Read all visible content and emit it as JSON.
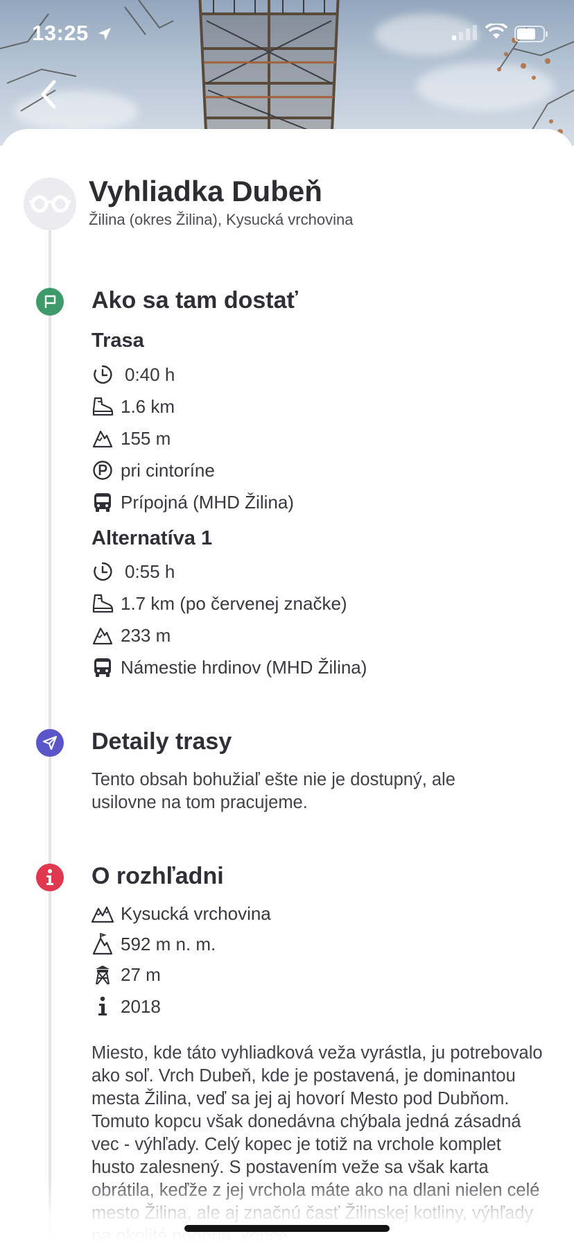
{
  "status_bar": {
    "time": "13:25"
  },
  "header": {
    "title": "Vyhliadka Dubeň",
    "subtitle": "Žilina (okres Žilina), Kysucká vrchovina"
  },
  "how_to_get": {
    "heading": "Ako sa tam dostať",
    "route": {
      "label": "Trasa",
      "duration": "0:40 h",
      "distance": "1.6 km",
      "elevation": "155 m",
      "parking": "pri cintoríne",
      "bus": "Prípojná (MHD Žilina)"
    },
    "alternative": {
      "label": "Alternatíva 1",
      "duration": "0:55 h",
      "distance": "1.7 km (po červenej značke)",
      "elevation": "233 m",
      "bus": "Námestie hrdinov (MHD Žilina)"
    }
  },
  "route_details": {
    "heading": "Detaily trasy",
    "text": "Tento obsah bohužiaľ ešte nie je dostupný, ale usilovne na tom pracujeme."
  },
  "about": {
    "heading": "O rozhľadni",
    "region": "Kysucká vrchovina",
    "altitude": "592 m n. m.",
    "height": "27 m",
    "year": "2018",
    "description": "Miesto, kde táto vyhliadková veža vyrástla, ju potrebovalo ako soľ. Vrch Dubeň, kde je postavená, je dominantou mesta Žilina, veď sa jej aj hovorí Mesto pod Dubňom. Tomuto kopcu však donedávna chýbala jedná zásadná vec - výhľady. Celý kopec je totiž na vrchole komplet husto zalesnený. S postavením veže sa však karta obrátila, keďže z jej vrchola máte ako na dlani nielen celé mesto Žilina, ale aj značnú časť Žilinskej kotliny, výhľady na okolité pohoria, kopce"
  },
  "colors": {
    "section_green": "#3f9a6b",
    "section_purple": "#5a55c9",
    "section_red": "#e0384e",
    "timeline": "#e4e4e9"
  },
  "icons": {
    "back": "chevron-left-icon",
    "avatar": "glasses-icon",
    "how_to_get": "flag-icon",
    "route_details": "navigation-arrow-icon",
    "about": "info-icon",
    "duration": "clock-icon",
    "distance": "hiking-boot-icon",
    "elevation": "mountain-icon",
    "parking": "parking-icon",
    "bus": "bus-icon",
    "region": "mountains-icon",
    "altitude": "mountain-peak-icon",
    "height": "tower-icon",
    "year": "info-i-icon"
  }
}
